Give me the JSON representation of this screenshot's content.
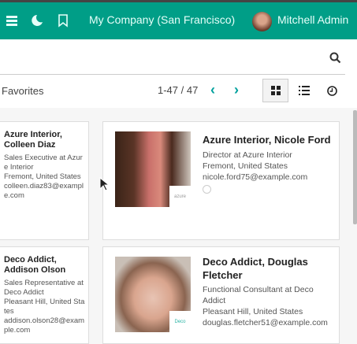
{
  "navbar": {
    "company": "My Company (San Francisco)",
    "user": "Mitchell Admin",
    "accent": "#009e87"
  },
  "searchbar": {
    "icon": "search-icon"
  },
  "controls": {
    "favorites": "Favorites",
    "pager": "1-47 / 47",
    "views": [
      "kanban",
      "list",
      "activity"
    ]
  },
  "cards": [
    {
      "title": "Azure Interior, Colleen Diaz",
      "job": "Sales Executive at Azure Interior",
      "location": "Fremont, United States",
      "email": "colleen.diaz83@example.com"
    },
    {
      "title": "Azure Interior, Nicole Ford",
      "job": "Director at Azure Interior",
      "location": "Fremont, United States",
      "email": "nicole.ford75@example.com",
      "badge": "azure"
    },
    {
      "title": "Deco Addict, Addison Olson",
      "job": "Sales Representative at Deco Addict",
      "location": "Pleasant Hill, United States",
      "email": "addison.olson28@example.com"
    },
    {
      "title": "Deco Addict, Douglas Fletcher",
      "job": "Functional Consultant at Deco Addict",
      "location": "Pleasant Hill, United States",
      "email": "douglas.fletcher51@example.com",
      "badge": "Deco"
    }
  ]
}
